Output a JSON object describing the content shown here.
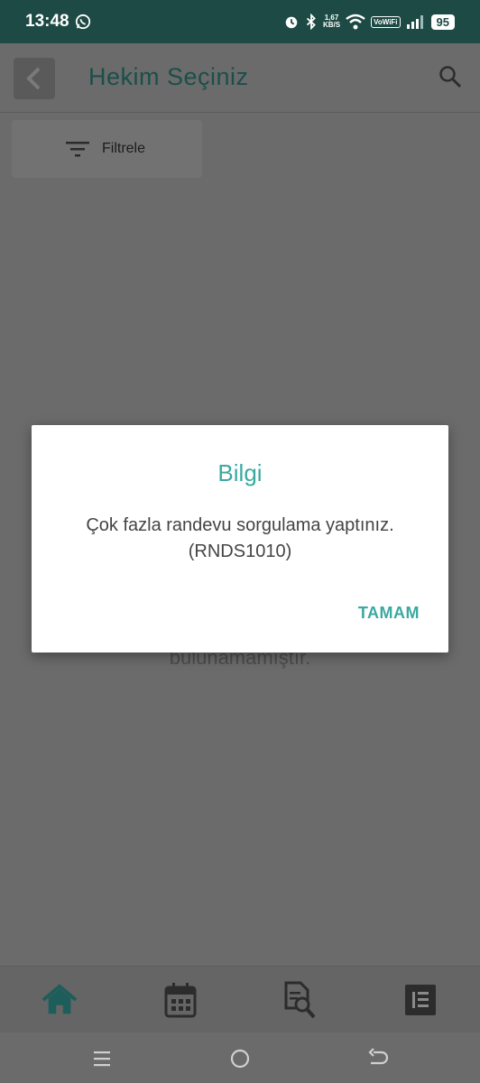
{
  "status_bar": {
    "time": "13:48",
    "speed_value": "1,67",
    "speed_unit": "KB/S",
    "vowifi": "VoWiFi",
    "battery": "95",
    "icons": [
      "whatsapp-icon",
      "alarm-icon",
      "bluetooth-icon",
      "wifi-icon",
      "signal-icon"
    ]
  },
  "header": {
    "title": "Hekim Seçiniz",
    "back_icon": "chevron-left-icon",
    "search_icon": "search-icon"
  },
  "filter": {
    "label": "Filtrele",
    "icon": "filter-icon"
  },
  "background_message": "bulunamamıştır.",
  "dialog": {
    "title": "Bilgi",
    "message_line1": "Çok fazla randevu sorgulama yaptınız.",
    "message_line2": "(RNDS1010)",
    "ok_label": "TAMAM"
  },
  "bottom_nav": {
    "items": [
      "home-icon",
      "calendar-icon",
      "document-search-icon",
      "list-icon"
    ],
    "active": "home-icon"
  },
  "system_nav": [
    "menu-icon",
    "home-circle-icon",
    "back-icon"
  ],
  "colors": {
    "status_bar": "#1d4a44",
    "accent": "#3aa9a0",
    "title": "#1b4f4a",
    "active_nav": "#1d5d5a",
    "overlay": "#6b6b6b"
  }
}
